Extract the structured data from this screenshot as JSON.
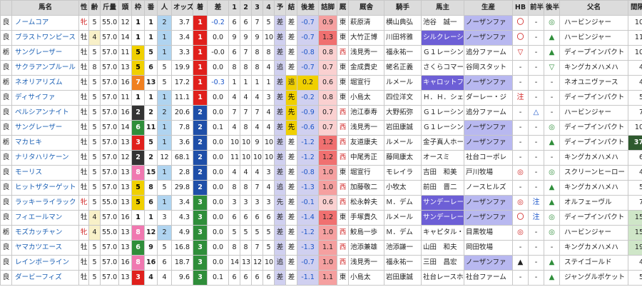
{
  "headers": [
    "馬名",
    "性",
    "齢",
    "斤量",
    "頭",
    "枠",
    "番",
    "人",
    "オッズ",
    "着",
    "差",
    "1",
    "2",
    "3",
    "4",
    "予",
    "結",
    "後差",
    "詰脚",
    "厩",
    "厩舎",
    "騎手",
    "馬主",
    "生産",
    "HB",
    "前半",
    "後半",
    "父名",
    "間隔"
  ],
  "colors": {
    "frame1": "#ffffff",
    "frame2": "#000000",
    "frame3": "#e0201c",
    "frame4": "#1a55c9",
    "frame5": "#f0d000",
    "frame6": "#2f8e3a",
    "frame7": "#f08020",
    "frame8": "#f078b0"
  },
  "rows": [
    {
      "cond": "良",
      "name": "ノームコア",
      "sex": "牝",
      "age": "5",
      "kin": "55.0",
      "heads": "12",
      "frame": "1",
      "num": "1",
      "pop": "2",
      "odds": "3.7",
      "finish": "1",
      "diff": "-0.2",
      "c1": "6",
      "c2": "6",
      "c3": "7",
      "c4": "5",
      "yo": "差",
      "ke": "差",
      "go": "-0.7",
      "tu": "0.9",
      "st": "東",
      "stable": "萩原清",
      "jockey": "横山典弘",
      "owner": "池谷　誠一",
      "breeder": "ノーザンファ",
      "hb": "〇",
      "zen": "-",
      "kou": "◎",
      "sire": "ハービンジャー",
      "days": "10"
    },
    {
      "cond": "良",
      "name": "ブラストワンピース",
      "sex": "牡",
      "age": "4",
      "kin": "57.0",
      "heads": "14",
      "frame": "1",
      "num": "1",
      "pop": "1",
      "odds": "3.4",
      "finish": "1",
      "diff": "0.0",
      "c1": "9",
      "c2": "9",
      "c3": "9",
      "c4": "10",
      "yo": "差",
      "ke": "差",
      "go": "-0.7",
      "tu": "1.3",
      "st": "東",
      "stable": "大竹正博",
      "jockey": "川田将雅",
      "owner": "シルクレーシ",
      "breeder": "ノーザンファ",
      "hb": "〇",
      "zen": "-",
      "kou": "▲",
      "sire": "ハービンジャー",
      "days": "11"
    },
    {
      "cond": "栃",
      "name": "サングレーザー",
      "sex": "牡",
      "age": "5",
      "kin": "57.0",
      "heads": "11",
      "frame": "5",
      "num": "5",
      "pop": "1",
      "odds": "3.3",
      "finish": "1",
      "diff": "-0.0",
      "c1": "6",
      "c2": "7",
      "c3": "8",
      "c4": "8",
      "yo": "差",
      "ke": "差",
      "go": "-0.8",
      "tu": "0.8",
      "st": "西",
      "stable": "浅見秀一",
      "jockey": "福永祐一",
      "owner": "Ｇ１レーシン",
      "breeder": "追分ファーム",
      "hb": "▽",
      "zen": "-",
      "kou": "▲",
      "sire": "ディープインパクト",
      "days": "10"
    },
    {
      "cond": "良",
      "name": "サクラアンプルール",
      "sex": "牡",
      "age": "8",
      "kin": "57.0",
      "heads": "13",
      "frame": "5",
      "num": "6",
      "pop": "5",
      "odds": "19.9",
      "finish": "1",
      "diff": "0.0",
      "c1": "8",
      "c2": "8",
      "c3": "8",
      "c4": "4",
      "yo": "追",
      "ke": "差",
      "go": "-0.7",
      "tu": "0.7",
      "st": "東",
      "stable": "金成貴史",
      "jockey": "蛯名正義",
      "owner": "さくらコマー",
      "breeder": "谷岡スタット",
      "hb": "-",
      "zen": "-",
      "kou": "▽",
      "sire": "キングカメハメハ",
      "days": "4"
    },
    {
      "cond": "栃",
      "name": "ネオリアリズム",
      "sex": "牡",
      "age": "5",
      "kin": "57.0",
      "heads": "16",
      "frame": "7",
      "num": "13",
      "pop": "5",
      "odds": "17.2",
      "finish": "1",
      "diff": "-0.3",
      "c1": "1",
      "c2": "1",
      "c3": "1",
      "c4": "1",
      "yo": "差",
      "ke": "逃",
      "go": "0.2",
      "tu": "0.6",
      "st": "東",
      "stable": "堀宣行",
      "jockey": "ルメール",
      "owner": "キャロットフ",
      "breeder": "ノーザンファ",
      "hb": "-",
      "zen": "-",
      "kou": "-",
      "sire": "ネオユニヴァース",
      "days": "4"
    },
    {
      "cond": "良",
      "name": "ディサイファ",
      "sex": "牡",
      "age": "5",
      "kin": "57.0",
      "heads": "11",
      "frame": "1",
      "num": "1",
      "pop": "1",
      "odds": "11.1",
      "finish": "1",
      "diff": "0.0",
      "c1": "4",
      "c2": "4",
      "c3": "4",
      "c4": "3",
      "yo": "差",
      "ke": "先",
      "go": "-0.2",
      "tu": "0.8",
      "st": "東",
      "stable": "小島太",
      "jockey": "四位洋文",
      "owner": "Ｈ．Ｈ．シェ",
      "breeder": "ダーレー・ジ",
      "hb": "注",
      "zen": "-",
      "kou": "-",
      "sire": "ディープインパクト",
      "days": "5"
    },
    {
      "cond": "良",
      "name": "ペルシアンナイト",
      "sex": "牡",
      "age": "5",
      "kin": "57.0",
      "heads": "16",
      "frame": "2",
      "num": "2",
      "pop": "2",
      "odds": "20.6",
      "finish": "2",
      "diff": "0.0",
      "c1": "7",
      "c2": "7",
      "c3": "7",
      "c4": "4",
      "yo": "差",
      "ke": "先",
      "go": "-0.9",
      "tu": "0.7",
      "st": "西",
      "stable": "池江泰寿",
      "jockey": "大野拓弥",
      "owner": "Ｇ１レーシン",
      "breeder": "追分ファーム",
      "hb": "-",
      "zen": "△",
      "kou": "-",
      "sire": "ハービンジャー",
      "days": "7"
    },
    {
      "cond": "良",
      "name": "サングレーザー",
      "sex": "牡",
      "age": "5",
      "kin": "57.0",
      "heads": "14",
      "frame": "6",
      "num": "11",
      "pop": "1",
      "odds": "7.8",
      "finish": "2",
      "diff": "0.1",
      "c1": "4",
      "c2": "8",
      "c3": "4",
      "c4": "4",
      "yo": "差",
      "ke": "先",
      "go": "-0.6",
      "tu": "0.7",
      "st": "西",
      "stable": "浅見秀一",
      "jockey": "岩田康誠",
      "owner": "Ｇ１レーシン",
      "breeder": "ノーザンファ",
      "hb": "-",
      "zen": "-",
      "kou": "◎",
      "sire": "ディープインパクト",
      "days": "10"
    },
    {
      "cond": "栃",
      "name": "マカヒキ",
      "sex": "牡",
      "age": "5",
      "kin": "57.0",
      "heads": "13",
      "frame": "3",
      "num": "5",
      "pop": "1",
      "odds": "3.6",
      "finish": "2",
      "diff": "0.0",
      "c1": "10",
      "c2": "10",
      "c3": "9",
      "c4": "10",
      "yo": "差",
      "ke": "差",
      "go": "-1.2",
      "tu": "1.2",
      "st": "西",
      "stable": "友道康夫",
      "jockey": "ルメール",
      "owner": "金子真人ホー",
      "breeder": "ノーザンファ",
      "hb": "-",
      "zen": "-",
      "kou": "▲",
      "sire": "ディープインパクト",
      "days": "37"
    },
    {
      "cond": "良",
      "name": "ナリタハリケーン",
      "sex": "牡",
      "age": "5",
      "kin": "57.0",
      "heads": "12",
      "frame": "2",
      "num": "2",
      "pop": "12",
      "odds": "68.1",
      "finish": "2",
      "diff": "0.0",
      "c1": "11",
      "c2": "10",
      "c3": "10",
      "c4": "10",
      "yo": "差",
      "ke": "差",
      "go": "-1.2",
      "tu": "1.2",
      "st": "西",
      "stable": "中尾秀正",
      "jockey": "藤岡康太",
      "owner": "オースミ",
      "breeder": "社台コーポレ",
      "hb": "-",
      "zen": "-",
      "kou": "-",
      "sire": "キングカメハメハ",
      "days": "6"
    },
    {
      "cond": "良",
      "name": "モーリス",
      "sex": "牡",
      "age": "5",
      "kin": "57.0",
      "heads": "13",
      "frame": "8",
      "num": "15",
      "pop": "1",
      "odds": "2.8",
      "finish": "2",
      "diff": "0.0",
      "c1": "4",
      "c2": "4",
      "c3": "4",
      "c4": "3",
      "yo": "差",
      "ke": "差",
      "go": "-0.8",
      "tu": "1.0",
      "st": "東",
      "stable": "堀宣行",
      "jockey": "モレイラ",
      "owner": "吉田　和美",
      "breeder": "戸川牧場",
      "hb": "◎",
      "zen": "-",
      "kou": "◎",
      "sire": "スクリーンヒーロー",
      "days": "4"
    },
    {
      "cond": "良",
      "name": "ヒットザターゲット",
      "sex": "牡",
      "age": "5",
      "kin": "57.0",
      "heads": "13",
      "frame": "5",
      "num": "8",
      "pop": "5",
      "odds": "29.8",
      "finish": "2",
      "diff": "0.0",
      "c1": "8",
      "c2": "8",
      "c3": "7",
      "c4": "4",
      "yo": "追",
      "ke": "差",
      "go": "-1.3",
      "tu": "1.0",
      "st": "西",
      "stable": "加藤敬二",
      "jockey": "小牧太",
      "owner": "前田　晋二",
      "breeder": "ノースヒルズ",
      "hb": "-",
      "zen": "-",
      "kou": "▲",
      "sire": "キングカメハメハ",
      "days": "5"
    },
    {
      "cond": "良",
      "name": "ラッキーライラック",
      "sex": "牝",
      "age": "5",
      "kin": "55.0",
      "heads": "13",
      "frame": "5",
      "num": "6",
      "pop": "1",
      "odds": "3.4",
      "finish": "3",
      "diff": "0.0",
      "c1": "3",
      "c2": "3",
      "c3": "3",
      "c4": "3",
      "yo": "先",
      "ke": "差",
      "go": "-0.1",
      "tu": "0.6",
      "st": "西",
      "stable": "松永幹夫",
      "jockey": "Ｍ．デム",
      "owner": "サンデーレー",
      "breeder": "ノーザンファ",
      "hb": "◎",
      "zen": "注",
      "kou": "▲",
      "sire": "オルフェーヴル",
      "days": "7"
    },
    {
      "cond": "良",
      "name": "フィエールマン",
      "sex": "牡",
      "age": "4",
      "kin": "57.0",
      "heads": "16",
      "frame": "1",
      "num": "1",
      "pop": "3",
      "odds": "4.3",
      "finish": "3",
      "diff": "0.0",
      "c1": "6",
      "c2": "6",
      "c3": "6",
      "c4": "6",
      "yo": "差",
      "ke": "差",
      "go": "-1.4",
      "tu": "1.2",
      "st": "東",
      "stable": "手塚貴久",
      "jockey": "ルメール",
      "owner": "サンデーレー",
      "breeder": "ノーザンファ",
      "hb": "〇",
      "zen": "注",
      "kou": "◎",
      "sire": "ディープインパクト",
      "days": "15"
    },
    {
      "cond": "栃",
      "name": "モズカッチャン",
      "sex": "牝",
      "age": "4",
      "kin": "55.0",
      "heads": "13",
      "frame": "8",
      "num": "12",
      "pop": "2",
      "odds": "4.9",
      "finish": "3",
      "diff": "0.0",
      "c1": "5",
      "c2": "5",
      "c3": "5",
      "c4": "5",
      "yo": "差",
      "ke": "差",
      "go": "-1.2",
      "tu": "1.0",
      "st": "西",
      "stable": "鮫島一歩",
      "jockey": "Ｍ．デム",
      "owner": "キャピタル・",
      "breeder": "目黒牧場",
      "hb": "◎",
      "zen": "-",
      "kou": "◎",
      "sire": "ハービンジャー",
      "days": "15"
    },
    {
      "cond": "良",
      "name": "ヤマカツエース",
      "sex": "牡",
      "age": "5",
      "kin": "57.0",
      "heads": "13",
      "frame": "6",
      "num": "9",
      "pop": "5",
      "odds": "16.8",
      "finish": "3",
      "diff": "0.0",
      "c1": "8",
      "c2": "8",
      "c3": "7",
      "c4": "5",
      "yo": "差",
      "ke": "差",
      "go": "-1.3",
      "tu": "1.1",
      "st": "西",
      "stable": "池添兼雄",
      "jockey": "池添謙一",
      "owner": "山田　和夫",
      "breeder": "岡田牧場",
      "hb": "-",
      "zen": "-",
      "kou": "-",
      "sire": "キングカメハメハ",
      "days": "19"
    },
    {
      "cond": "良",
      "name": "レインボーライン",
      "sex": "牡",
      "age": "5",
      "kin": "57.0",
      "heads": "16",
      "frame": "8",
      "num": "16",
      "pop": "6",
      "odds": "18.7",
      "finish": "3",
      "diff": "0.0",
      "c1": "14",
      "c2": "13",
      "c3": "12",
      "c4": "10",
      "yo": "追",
      "ke": "差",
      "go": "-0.7",
      "tu": "1.0",
      "st": "西",
      "stable": "浅見秀一",
      "jockey": "福永祐一",
      "owner": "三田　昌宏",
      "breeder": "ノーザンファ",
      "hb": "▲",
      "zen": "-",
      "kou": "▲",
      "sire": "ステイゴールド",
      "days": "4"
    },
    {
      "cond": "良",
      "name": "ダービーフィズ",
      "sex": "牡",
      "age": "5",
      "kin": "57.0",
      "heads": "13",
      "frame": "3",
      "num": "4",
      "pop": "4",
      "odds": "9.6",
      "finish": "3",
      "diff": "0.1",
      "c1": "6",
      "c2": "6",
      "c3": "6",
      "c4": "6",
      "yo": "差",
      "ke": "差",
      "go": "-1.1",
      "tu": "1.1",
      "st": "東",
      "stable": "小島太",
      "jockey": "岩田康誠",
      "owner": "社台レースホ",
      "breeder": "社台ファーム",
      "hb": "-",
      "zen": "-",
      "kou": "▲",
      "sire": "ジャングルポケット",
      "days": "5"
    }
  ]
}
